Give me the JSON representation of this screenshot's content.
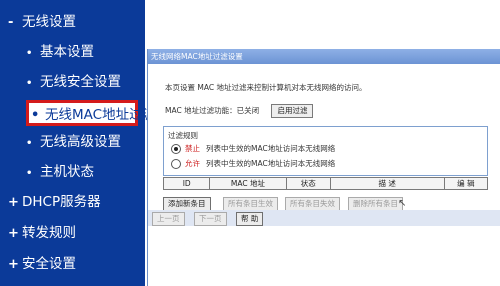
{
  "sidebar": {
    "items": [
      {
        "label": "无线设置",
        "type": "section"
      },
      {
        "label": "基本设置",
        "type": "sub"
      },
      {
        "label": "无线安全设置",
        "type": "sub"
      },
      {
        "label": "无线MAC地址过滤",
        "type": "sub",
        "active": true
      },
      {
        "label": "无线高级设置",
        "type": "sub"
      },
      {
        "label": "主机状态",
        "type": "sub"
      },
      {
        "label": "DHCP服务器",
        "type": "section"
      },
      {
        "label": "转发规则",
        "type": "section"
      },
      {
        "label": "安全设置",
        "type": "section"
      }
    ]
  },
  "dialog": {
    "title": "无线网络MAC地址过滤设置",
    "description": "本页设置 MAC 地址过滤来控制计算机对本无线网络的访问。",
    "status_label": "MAC 地址过滤功能：已关闭",
    "enable_button": "启用过滤",
    "rules_title": "过滤规则",
    "rule_deny_keyword": "禁止",
    "rule_deny_text": "列表中生效的MAC地址访问本无线网络",
    "rule_allow_keyword": "允许",
    "rule_allow_text": "列表中生效的MAC地址访问本无线网络",
    "rule_selected": "禁止",
    "table_headers": [
      "ID",
      "MAC 地址",
      "状态",
      "描 述",
      "编 辑"
    ],
    "buttons": {
      "add": "添加新条目",
      "enable_all": "所有条目生效",
      "disable_all": "所有条目失效",
      "delete_all": "删除所有条目",
      "prev": "上一页",
      "next": "下一页",
      "help": "帮 助"
    }
  },
  "colors": {
    "sidebar_bg": "#0b3a99",
    "active_border": "#d41b1b",
    "title_bar": "#7a9edc"
  }
}
